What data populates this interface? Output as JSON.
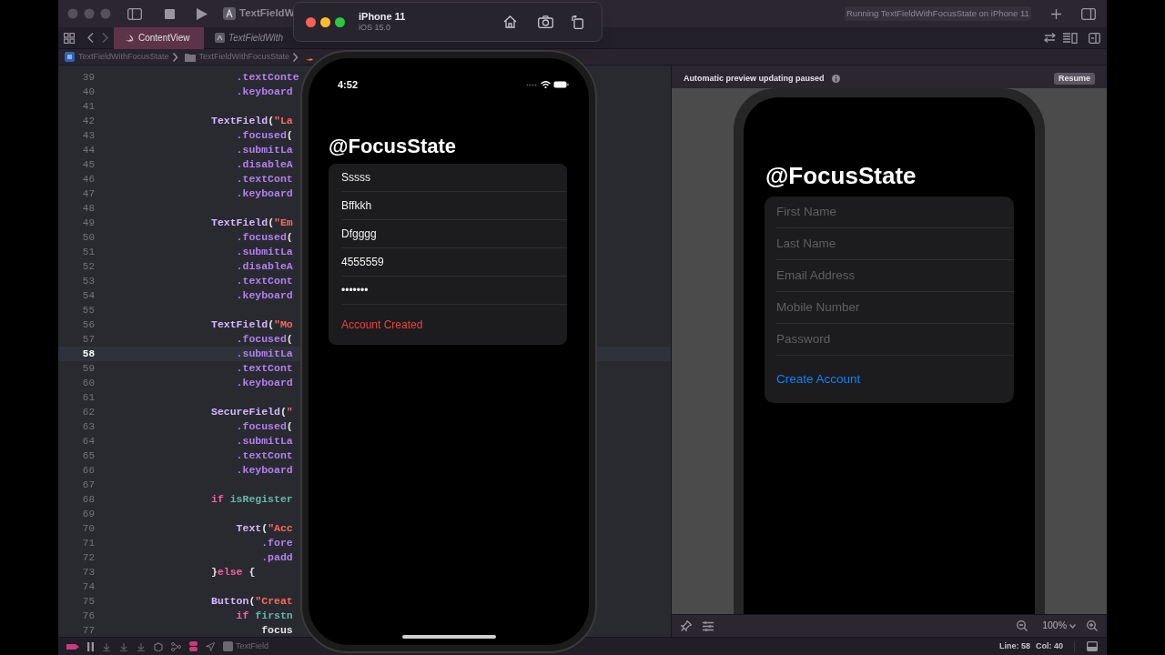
{
  "toolbar": {
    "scheme": "TextFieldW",
    "activity": "Running TextFieldWithFocusState on iPhone 11"
  },
  "tabs": [
    {
      "label": "ContentView",
      "selected": true
    },
    {
      "label": "TextFieldWith",
      "selected": false
    }
  ],
  "breadcrumb": [
    "TextFieldWithFocusState",
    "TextFieldWithFocusState"
  ],
  "editor": {
    "lines": [
      {
        "number": "39",
        "current": false,
        "tokens": [
          {
            "kind": "method",
            "text": "    .textConte"
          }
        ]
      },
      {
        "number": "40",
        "current": false,
        "tokens": [
          {
            "kind": "method",
            "text": "    .keyboard"
          }
        ]
      },
      {
        "number": "41",
        "current": false
      },
      {
        "number": "42",
        "current": false,
        "tokens": [
          {
            "kind": "type",
            "text": "TextField"
          },
          {
            "kind": "plain",
            "text": "("
          },
          {
            "kind": "string",
            "text": "\"La"
          }
        ]
      },
      {
        "number": "43",
        "current": false,
        "tokens": [
          {
            "kind": "method",
            "text": "    .focused"
          },
          {
            "kind": "plain",
            "text": "("
          }
        ]
      },
      {
        "number": "44",
        "current": false,
        "tokens": [
          {
            "kind": "method",
            "text": "    .submitLa"
          }
        ]
      },
      {
        "number": "45",
        "current": false,
        "tokens": [
          {
            "kind": "method",
            "text": "    .disableA"
          }
        ]
      },
      {
        "number": "46",
        "current": false,
        "tokens": [
          {
            "kind": "method",
            "text": "    .textCont"
          }
        ]
      },
      {
        "number": "47",
        "current": false,
        "tokens": [
          {
            "kind": "method",
            "text": "    .keyboard"
          }
        ]
      },
      {
        "number": "48",
        "current": false
      },
      {
        "number": "49",
        "current": false,
        "tokens": [
          {
            "kind": "type",
            "text": "TextField"
          },
          {
            "kind": "plain",
            "text": "("
          },
          {
            "kind": "string",
            "text": "\"Em"
          }
        ]
      },
      {
        "number": "50",
        "current": false,
        "tokens": [
          {
            "kind": "method",
            "text": "    .focused"
          },
          {
            "kind": "plain",
            "text": "("
          }
        ]
      },
      {
        "number": "51",
        "current": false,
        "tokens": [
          {
            "kind": "method",
            "text": "    .submitLa"
          }
        ]
      },
      {
        "number": "52",
        "current": false,
        "tokens": [
          {
            "kind": "method",
            "text": "    .disableA"
          }
        ]
      },
      {
        "number": "53",
        "current": false,
        "tokens": [
          {
            "kind": "method",
            "text": "    .textCont"
          }
        ]
      },
      {
        "number": "54",
        "current": false,
        "tokens": [
          {
            "kind": "method",
            "text": "    .keyboard"
          }
        ]
      },
      {
        "number": "55",
        "current": false
      },
      {
        "number": "56",
        "current": false,
        "tokens": [
          {
            "kind": "type",
            "text": "TextField"
          },
          {
            "kind": "plain",
            "text": "("
          },
          {
            "kind": "string",
            "text": "\"Mo"
          }
        ]
      },
      {
        "number": "57",
        "current": false,
        "tokens": [
          {
            "kind": "method",
            "text": "    .focused"
          },
          {
            "kind": "plain",
            "text": "("
          }
        ]
      },
      {
        "number": "58",
        "current": true,
        "tokens": [
          {
            "kind": "method",
            "text": "    .submitLa"
          }
        ]
      },
      {
        "number": "59",
        "current": false,
        "tokens": [
          {
            "kind": "method",
            "text": "    .textCont"
          }
        ]
      },
      {
        "number": "60",
        "current": false,
        "tokens": [
          {
            "kind": "method",
            "text": "    .keyboard"
          }
        ]
      },
      {
        "number": "61",
        "current": false
      },
      {
        "number": "62",
        "current": false,
        "tokens": [
          {
            "kind": "type",
            "text": "SecureField"
          },
          {
            "kind": "plain",
            "text": "("
          },
          {
            "kind": "string",
            "text": "\""
          }
        ]
      },
      {
        "number": "63",
        "current": false,
        "tokens": [
          {
            "kind": "method",
            "text": "    .focused"
          },
          {
            "kind": "plain",
            "text": "("
          }
        ]
      },
      {
        "number": "64",
        "current": false,
        "tokens": [
          {
            "kind": "method",
            "text": "    .submitLa"
          }
        ]
      },
      {
        "number": "65",
        "current": false,
        "tokens": [
          {
            "kind": "method",
            "text": "    .textCont"
          }
        ]
      },
      {
        "number": "66",
        "current": false,
        "tokens": [
          {
            "kind": "method",
            "text": "    .keyboard"
          }
        ]
      },
      {
        "number": "67",
        "current": false
      },
      {
        "number": "68",
        "current": false,
        "tokens": [
          {
            "kind": "keyword",
            "text": "if"
          },
          {
            "kind": "variable",
            "text": " isRegister"
          }
        ]
      },
      {
        "number": "69",
        "current": false
      },
      {
        "number": "70",
        "current": false,
        "tokens": [
          {
            "kind": "type",
            "text": "    Text"
          },
          {
            "kind": "plain",
            "text": "("
          },
          {
            "kind": "string",
            "text": "\"Acc"
          }
        ]
      },
      {
        "number": "71",
        "current": false,
        "tokens": [
          {
            "kind": "method",
            "text": "        .fore"
          }
        ]
      },
      {
        "number": "72",
        "current": false,
        "tokens": [
          {
            "kind": "method",
            "text": "        .padd"
          }
        ]
      },
      {
        "number": "73",
        "current": false,
        "tokens": [
          {
            "kind": "plain",
            "text": "}"
          },
          {
            "kind": "keyword",
            "text": "else"
          },
          {
            "kind": "plain",
            "text": " {"
          }
        ]
      },
      {
        "number": "74",
        "current": false
      },
      {
        "number": "75",
        "current": false,
        "tokens": [
          {
            "kind": "type",
            "text": "Button"
          },
          {
            "kind": "plain",
            "text": "("
          },
          {
            "kind": "string",
            "text": "\"Creat"
          }
        ]
      },
      {
        "number": "76",
        "current": false,
        "tokens": [
          {
            "kind": "keyword",
            "text": "    if"
          },
          {
            "kind": "variable",
            "text": " firstn"
          }
        ]
      },
      {
        "number": "77",
        "current": false,
        "tokens": [
          {
            "kind": "plain",
            "text": "        focus"
          }
        ]
      }
    ]
  },
  "simulator": {
    "device": "iPhone 11",
    "os": "iOS 15.0"
  },
  "phone": {
    "time": "4:52",
    "title": "@FocusState",
    "fields": [
      {
        "value": "Sssss"
      },
      {
        "value": "Bffkkh"
      },
      {
        "value": "Dfgggg"
      },
      {
        "value": "4555559"
      },
      {
        "value": "•••••••"
      }
    ],
    "message": "Account Created"
  },
  "preview": {
    "notice": "Automatic preview updating paused",
    "resume": "Resume",
    "title": "@FocusState",
    "fields": [
      {
        "placeholder": "First Name"
      },
      {
        "placeholder": "Last Name"
      },
      {
        "placeholder": "Email Address"
      },
      {
        "placeholder": "Mobile Number"
      },
      {
        "placeholder": "Password"
      }
    ],
    "button": "Create Account",
    "zoom": "100%"
  },
  "status_bar": {
    "target": "TextField",
    "line": "Line: 58",
    "column": "Col: 40"
  }
}
